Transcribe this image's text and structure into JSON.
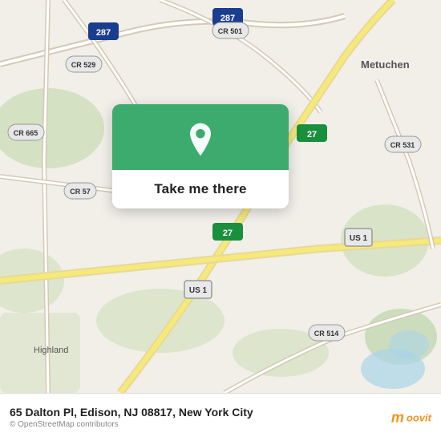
{
  "map": {
    "background_color": "#f2efe9",
    "center_lat": 40.52,
    "center_lng": -74.38
  },
  "popup": {
    "button_label": "Take me there",
    "bg_color": "#3dab6e",
    "pin_color": "#fff"
  },
  "bottom_bar": {
    "address": "65 Dalton Pl, Edison, NJ 08817, New York City",
    "attribution": "© OpenStreetMap contributors",
    "logo_text": "moovit"
  }
}
